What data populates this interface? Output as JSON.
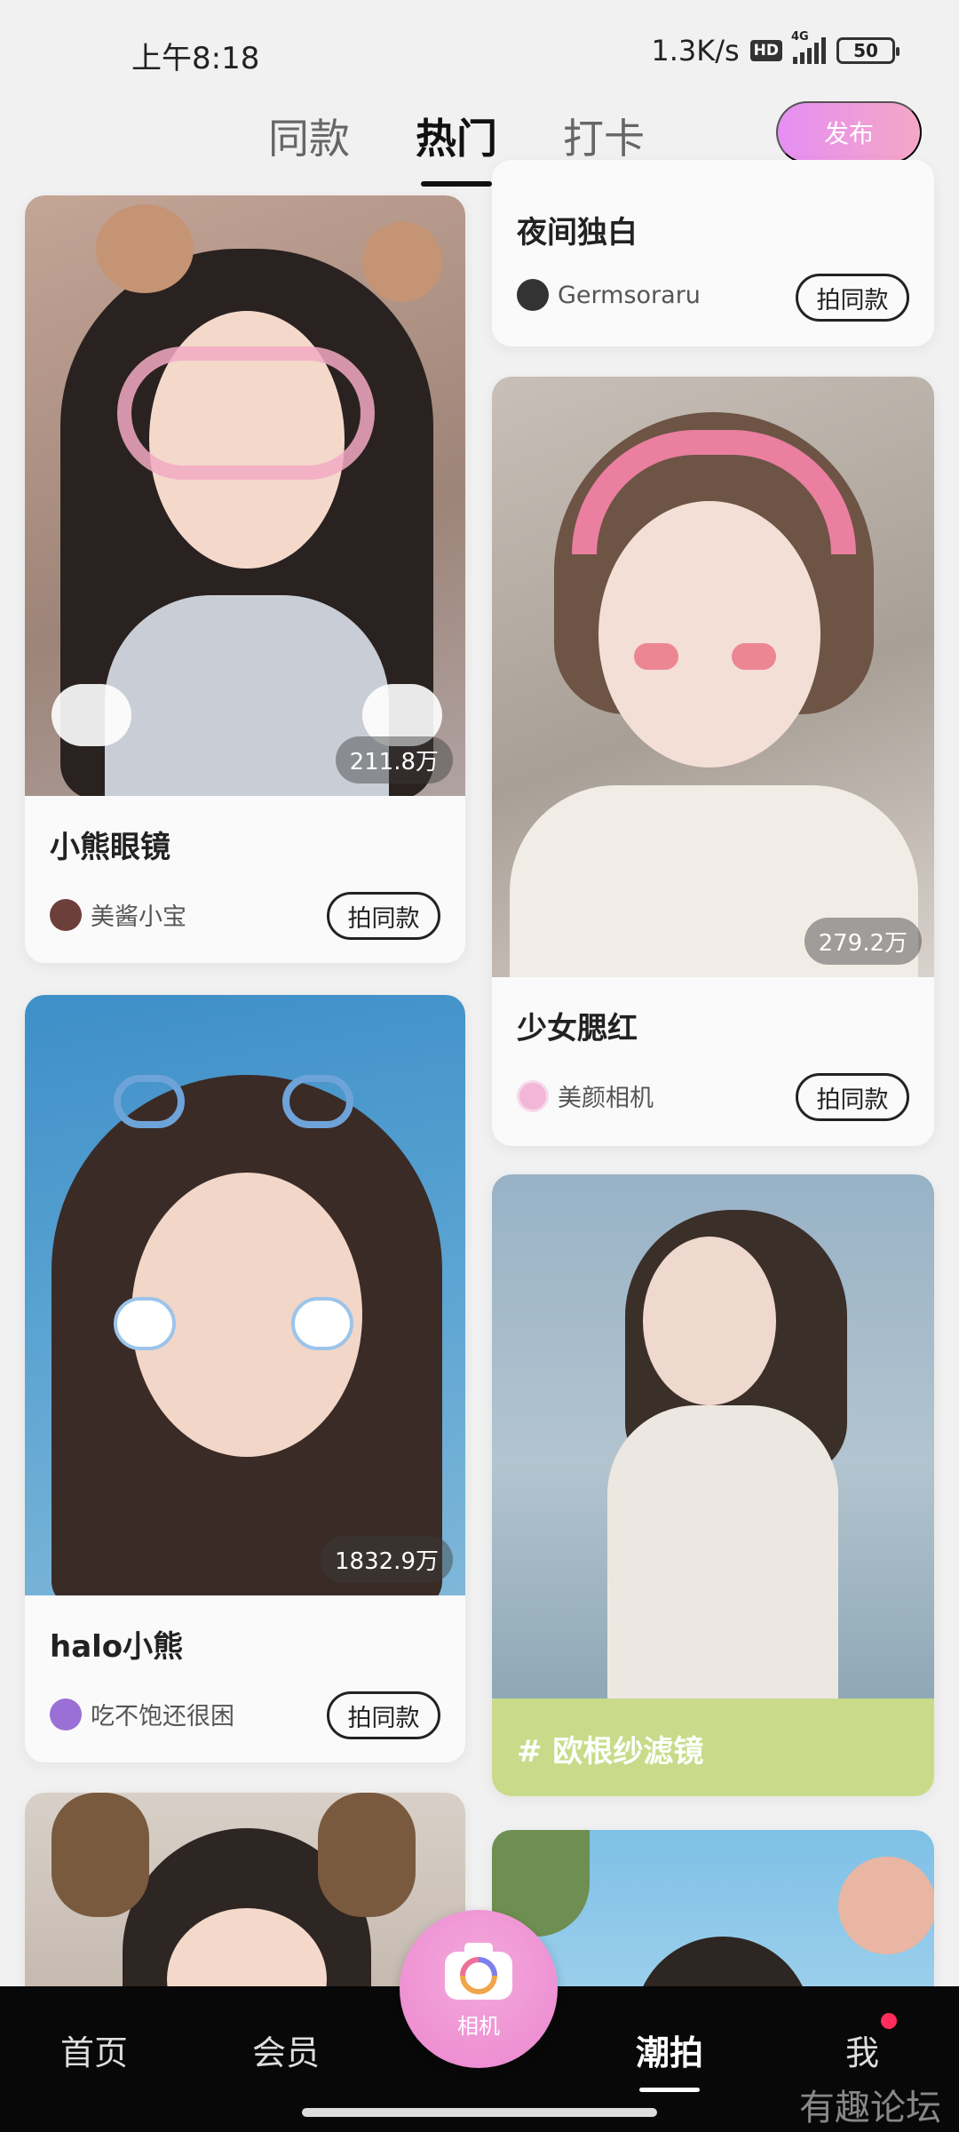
{
  "status_bar": {
    "time": "上午8:18",
    "net_speed": "1.3K/s",
    "hd": "HD",
    "network": "4G",
    "battery": "50"
  },
  "tabs": [
    {
      "label": "同款"
    },
    {
      "label": "热门"
    },
    {
      "label": "打卡"
    }
  ],
  "publish_label": "发布",
  "cards": {
    "c1": {
      "title": "小熊眼镜",
      "count": "211.8万",
      "author": "美酱小宝",
      "action": "拍同款"
    },
    "c2": {
      "title": "夜间独白",
      "author": "Germsoraru",
      "action": "拍同款"
    },
    "c3": {
      "title": "少女腮红",
      "count": "279.2万",
      "author": "美颜相机",
      "action": "拍同款"
    },
    "c4": {
      "title": "halo小熊",
      "count": "1832.9万",
      "author": "吃不饱还很困",
      "action": "拍同款"
    },
    "c5": {
      "tag": "# 欧根纱滤镜"
    }
  },
  "bottom_nav": {
    "home": "首页",
    "member": "会员",
    "camera": "相机",
    "trend": "潮拍",
    "me": "我"
  },
  "watermark": "有趣论坛"
}
